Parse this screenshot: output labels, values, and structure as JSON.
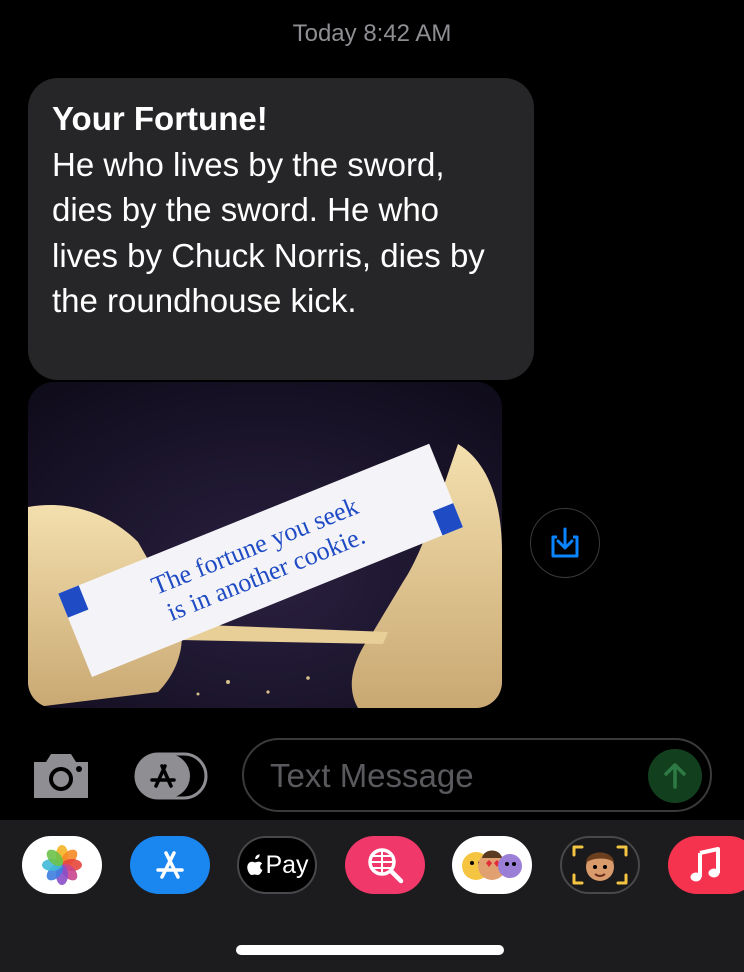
{
  "header": {
    "timestamp": "Today 8:42 AM"
  },
  "message": {
    "title": "Your Fortune!",
    "body": "He who lives by the sword, dies by the sword. He who lives by Chuck Norris, dies by the roundhouse kick."
  },
  "image_message": {
    "fortune_line1": "The fortune you seek",
    "fortune_line2": "is in another cookie."
  },
  "compose": {
    "placeholder": "Text Message"
  },
  "app_tray": {
    "apple_pay_label": "Pay"
  },
  "colors": {
    "bubble": "#262628",
    "accent_blue": "#0a84ff",
    "send_green": "#12401f"
  }
}
